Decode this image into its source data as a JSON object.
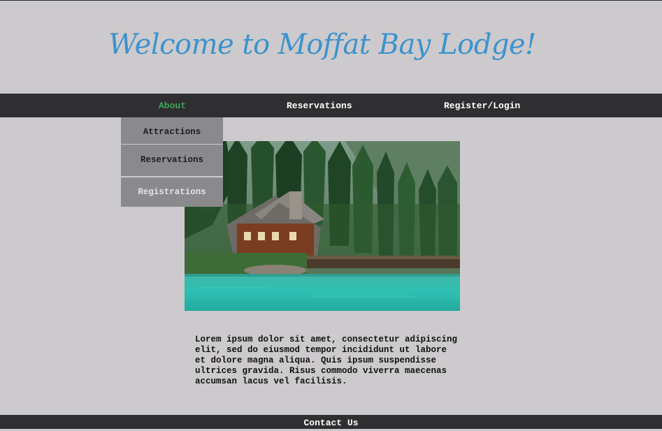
{
  "header": {
    "title": "Welcome to Moffat Bay Lodge!"
  },
  "nav": {
    "items": [
      {
        "label": "About",
        "active": true
      },
      {
        "label": "Reservations",
        "active": false
      },
      {
        "label": "Register/Login",
        "active": false
      }
    ]
  },
  "dropdown": {
    "items": [
      {
        "label": "Attractions"
      },
      {
        "label": "Reservations"
      },
      {
        "label": "Registrations"
      }
    ]
  },
  "main": {
    "image_subject": "lakeside lodge among pine trees",
    "body_text": "Lorem ipsum dolor sit amet, consectetur adipiscing elit, sed do eiusmod tempor incididunt ut labore et dolore magna aliqua. Quis ipsum suspendisse ultrices gravida. Risus commodo viverra maecenas accumsan lacus vel facilisis."
  },
  "footer": {
    "link_label": "Contact Us"
  },
  "colors": {
    "page_background": "#cdcacd",
    "nav_background": "#2f2e31",
    "title": "#3d93cc",
    "active_nav": "#41a55a",
    "dropdown_background": "#8a898c"
  }
}
